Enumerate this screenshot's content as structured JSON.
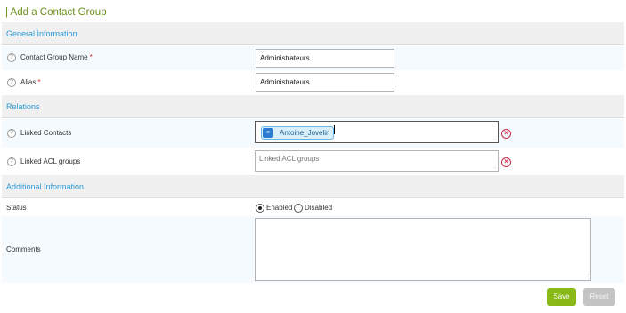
{
  "page": {
    "title": "| Add a Contact Group"
  },
  "sections": {
    "general": "General Information",
    "relations": "Relations",
    "additional": "Additional Information"
  },
  "help_icon_glyph": "?",
  "required_mark": "*",
  "fields": {
    "name": {
      "label": "Contact Group Name",
      "value": "Administrateurs",
      "required": true
    },
    "alias": {
      "label": "Alias",
      "value": "Administrateurs",
      "required": true
    },
    "linked_contacts": {
      "label": "Linked Contacts",
      "selected": [
        "Antoine_Jovelin"
      ],
      "chip_remove_glyph": "×"
    },
    "linked_acl": {
      "label": "Linked ACL groups",
      "placeholder": "Linked ACL groups"
    },
    "status": {
      "label": "Status",
      "options": [
        "Enabled",
        "Disabled"
      ],
      "selected": "Enabled"
    },
    "comments": {
      "label": "Comments",
      "value": ""
    }
  },
  "icons": {
    "help": "help-circle-icon",
    "clear": "clear-circle-icon",
    "chip_remove": "remove-x-icon",
    "resize": "resize-grip-icon"
  },
  "clear_glyph": "×",
  "resize_glyph": ".:",
  "buttons": {
    "save": "Save",
    "reset": "Reset"
  },
  "colors": {
    "title": "#6a8f1c",
    "section_header": "#2e9bd6",
    "required": "#d42e2e",
    "save": "#88b917",
    "reset": "#c4c4c4",
    "clear": "#cc2a43",
    "chip_bg": "#d9effa"
  }
}
